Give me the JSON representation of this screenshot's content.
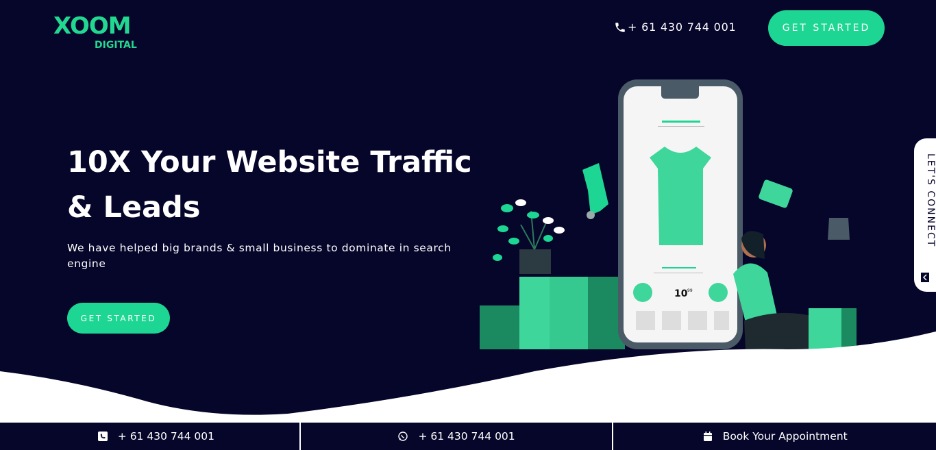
{
  "brand": {
    "logo_word": "XOOM",
    "logo_sub": "DIGITAL",
    "accent_color": "#1ed693",
    "background_color": "#06052a"
  },
  "header": {
    "phone": "+ 61 430 744 001",
    "phone_icon": "phone-icon",
    "cta_label": "GET STARTED"
  },
  "hero": {
    "headline_line1": "10X Your Website Traffic",
    "headline_line2": "& Leads",
    "subline": "We have helped big brands & small business to dominate in search engine",
    "cta_label": "GET STARTED",
    "illustration": {
      "price_main": "10",
      "price_cents": "99"
    }
  },
  "side_tab": {
    "label": "LET'S CONNECT"
  },
  "bottom_bar": {
    "items": [
      {
        "icon": "phone-square-icon",
        "label": "+ 61 430 744 001"
      },
      {
        "icon": "whatsapp-icon",
        "label": "+ 61 430 744 001"
      },
      {
        "icon": "calendar-icon",
        "label": "Book Your Appointment"
      }
    ]
  }
}
